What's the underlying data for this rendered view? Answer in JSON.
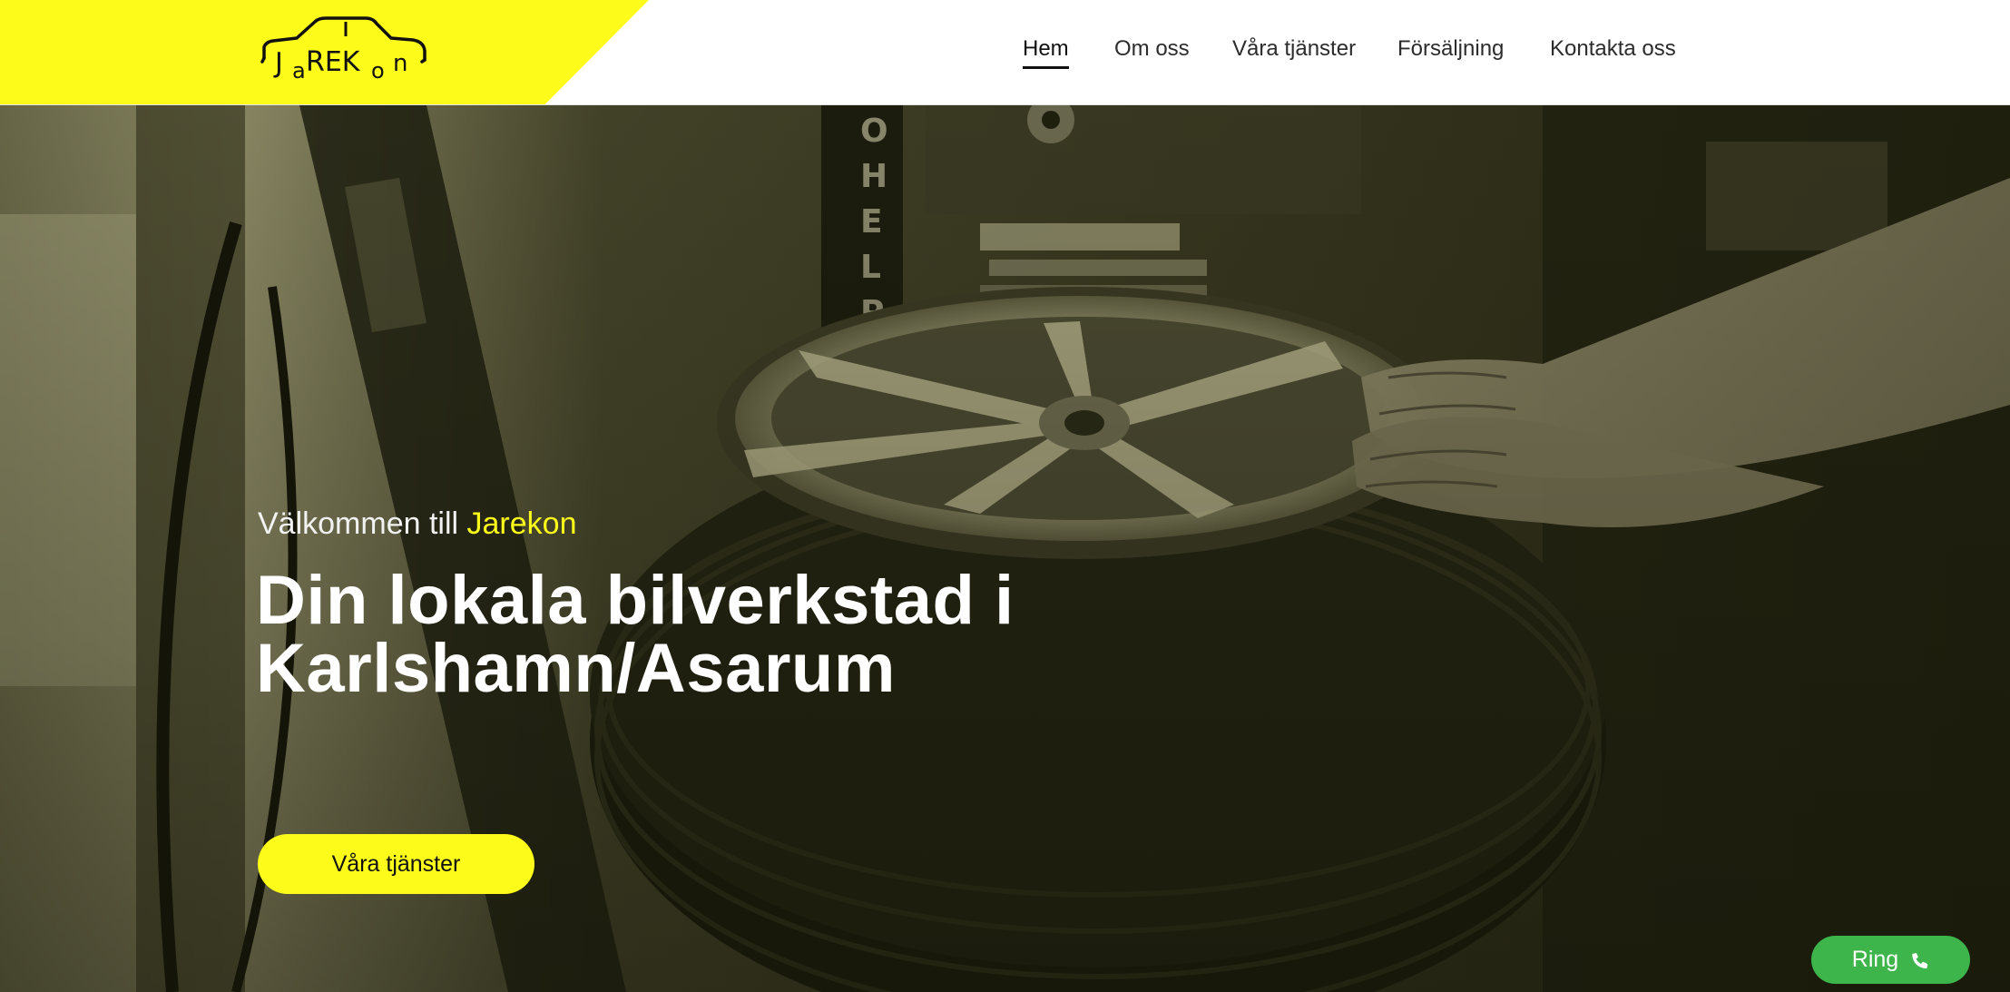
{
  "header": {
    "logo_text": "JaREKon",
    "nav": [
      {
        "label": "Hem",
        "active": true
      },
      {
        "label": "Om oss",
        "active": false
      },
      {
        "label": "Våra tjänster",
        "active": false
      },
      {
        "label": "Försäljning",
        "active": false
      },
      {
        "label": "Kontakta oss",
        "active": false
      }
    ]
  },
  "hero": {
    "welcome_prefix": "Välkommen till ",
    "welcome_brand": "Jarekon",
    "headline_line1": "Din lokala bilverkstad i",
    "headline_line2": "Karlshamn/Asarum",
    "cta_label": "Våra tjänster",
    "background_sign": "OHELP"
  },
  "call_button": {
    "label": "Ring",
    "icon": "phone-icon"
  },
  "colors": {
    "brand_yellow": "#fdfb1a",
    "call_green": "#3db54a",
    "nav_text": "#2c2c2c",
    "hero_tint": "#2a2b15"
  }
}
